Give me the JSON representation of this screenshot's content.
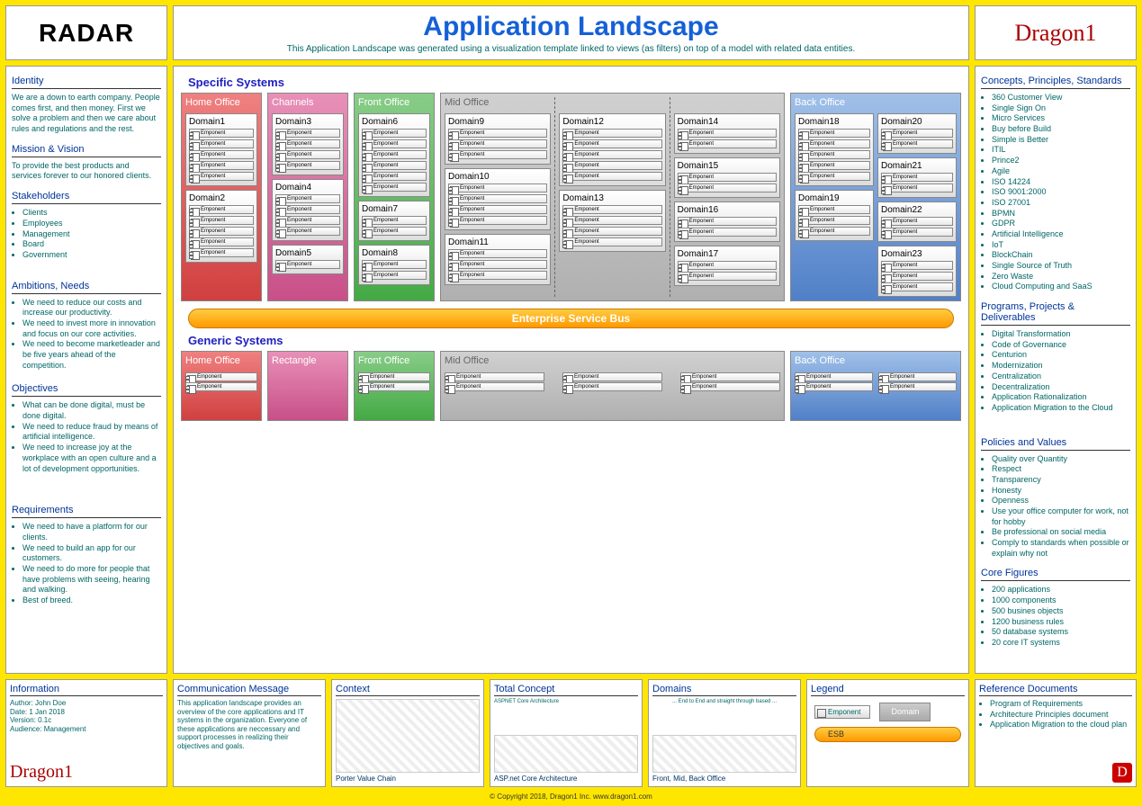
{
  "header": {
    "radar": "RADAR",
    "title": "Application Landscape",
    "subtitle": "This Application Landscape was generated using a visualization template linked to views (as filters) on top of a model with related data entities.",
    "brand": "Dragon1"
  },
  "left": {
    "identity": {
      "title": "Identity",
      "text": "We are a down to earth company. People comes first, and then money. First we solve a problem and then we care about rules and regulations and the rest."
    },
    "mission": {
      "title": "Mission & Vision",
      "text": "To provide the best products and services forever to our honored clients."
    },
    "stakeholders": {
      "title": "Stakeholders",
      "items": [
        "Clients",
        "Employees",
        "Management",
        "Board",
        "Government"
      ]
    },
    "ambitions": {
      "title": "Ambitions, Needs",
      "items": [
        "We need to reduce our costs and increase our productivity.",
        "We need to invest more in innovation and focus on our core activities.",
        "We need to become marketleader and be five years ahead of the competition."
      ]
    },
    "objectives": {
      "title": "Objectives",
      "items": [
        "What can be done digital, must be done digital.",
        "We need to reduce fraud by means of artificial intelligence.",
        "We need to increase joy at the workplace with an open culture and a lot of development opportunities."
      ]
    },
    "requirements": {
      "title": "Requirements",
      "items": [
        "We need to have a platform for our clients.",
        "We need to build an app for our customers.",
        "We need to do more for people that have problems with seeing, hearing and walking.",
        "Best of breed."
      ]
    }
  },
  "right": {
    "concepts": {
      "title": "Concepts, Principles, Standards",
      "items": [
        "360 Customer View",
        "Single Sign On",
        "Micro Services",
        "Buy before Build",
        "Simple is Better",
        "ITIL",
        "Prince2",
        "Agile",
        "ISO 14224",
        "ISO 9001:2000",
        "ISO 27001",
        "BPMN",
        "GDPR",
        "Artificial Intelligence",
        "IoT",
        "BlockChain",
        "Single Source of Truth",
        "Zero Waste",
        "Cloud Computing and SaaS"
      ]
    },
    "programs": {
      "title": "Programs, Projects & Deliverables",
      "items": [
        "Digital Transformation",
        "Code of Governance",
        "Centurion",
        "Modernization",
        "Centralization",
        "Decentralization",
        "Application Rationalization",
        "Application Migration to the Cloud"
      ]
    },
    "policies": {
      "title": "Policies and Values",
      "items": [
        "Quality over Quantity",
        "Respect",
        "Transparency",
        "Honesty",
        "Openness",
        "Use your office computer for work, not for hobby",
        "Be professional on social media",
        "Comply to standards when possible or explain why not"
      ]
    },
    "figures": {
      "title": "Core Figures",
      "items": [
        "200 applications",
        "1000 components",
        "500 busines objects",
        "1200 business rules",
        "50 database systems",
        "20 core IT systems"
      ]
    }
  },
  "center": {
    "specific": "Specific Systems",
    "generic": "Generic Systems",
    "esb": "Enterprise Service Bus",
    "offices": {
      "home": "Home Office",
      "channels": "Channels",
      "rectangle": "Rectangle",
      "front": "Front Office",
      "mid": "Mid Office",
      "back": "Back Office"
    },
    "component_label": "Emponent",
    "domains": {
      "d1": "Domain1",
      "d2": "Domain2",
      "d3": "Domain3",
      "d4": "Domain4",
      "d5": "Domain5",
      "d6": "Domain6",
      "d7": "Domain7",
      "d8": "Domain8",
      "d9": "Domain9",
      "d10": "Domain10",
      "d11": "Domain11",
      "d12": "Domain12",
      "d13": "Domain13",
      "d14": "Domain14",
      "d15": "Domain15",
      "d16": "Domain16",
      "d17": "Domain17",
      "d18": "Domain18",
      "d19": "Domain19",
      "d20": "Domain20",
      "d21": "Domain21",
      "d22": "Domain22",
      "d23": "Domain23"
    }
  },
  "footer": {
    "info": {
      "title": "Information",
      "author": "Author: John Doe",
      "date": "Date: 1 Jan 2018",
      "version": "Version: 0.1c",
      "audience": "Audience: Management",
      "brand": "Dragon1"
    },
    "comm": {
      "title": "Communication Message",
      "text": "This application landscape provides an overview of the core applications and IT systems in the organization. Everyone of these applications are neccessary and support processes in realizing their objectives and goals."
    },
    "context": {
      "title": "Context",
      "caption": "Porter Value Chain"
    },
    "concept": {
      "title": "Total Concept",
      "caption": "ASP.net Core Architecture",
      "sub": "ASPNET Core Architecture"
    },
    "domains": {
      "title": "Domains",
      "caption": "Front, Mid, Back Office",
      "sub": "... End to End and straight through based ..."
    },
    "legend": {
      "title": "Legend",
      "component": "Emponent",
      "domain": "Domain",
      "esb": "ESB"
    },
    "refs": {
      "title": "Reference Documents",
      "items": [
        "Program of Requirements",
        "Architecture Principles document",
        "Application Migration to the cloud plan"
      ]
    },
    "copyright": "© Copyright 2018, Dragon1 Inc. www.dragon1.com"
  }
}
